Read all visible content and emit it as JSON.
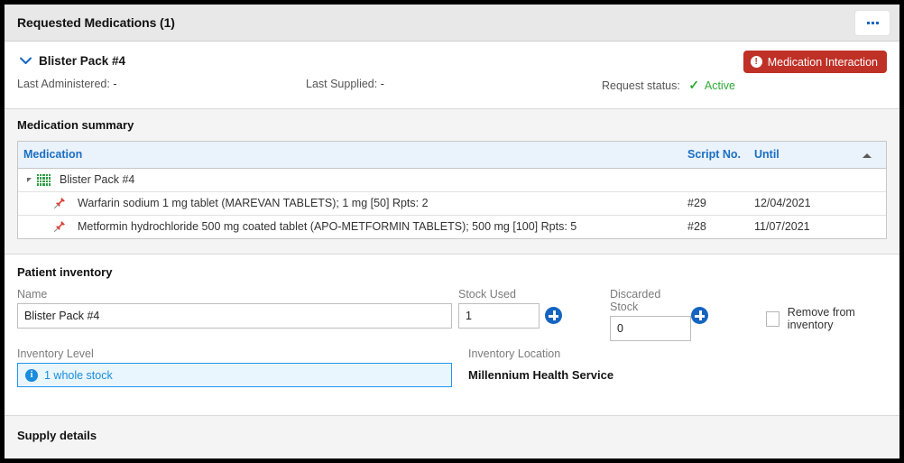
{
  "window": {
    "title": "Requested Medications (1)",
    "overflow_menu_label": "..."
  },
  "request": {
    "pack_name": "Blister Pack #4",
    "chevron_icon": "chevron-down-icon",
    "last_administered_label": "Last Administered:",
    "last_administered_value": "-",
    "last_supplied_label": "Last Supplied:",
    "last_supplied_value": "-",
    "request_status_label": "Request status:",
    "request_status_value": "Active",
    "status_check_icon": "check-icon",
    "interaction_badge": {
      "label": "Medication Interaction",
      "icon": "alert-exclamation-icon",
      "glyph": "!",
      "color": "#bf3026"
    }
  },
  "medication_summary": {
    "title": "Medication summary",
    "columns": {
      "medication": "Medication",
      "script_no": "Script No.",
      "until": "Until"
    },
    "sort_icon": "sort-ascending-icon",
    "group": {
      "label": "Blister Pack #4",
      "icon": "blister-pack-icon",
      "toggle_icon": "triangle-expanded-icon",
      "script_no": "",
      "until": ""
    },
    "rows": [
      {
        "icon": "pin-icon",
        "medication": "Warfarin sodium 1 mg tablet (MAREVAN TABLETS); 1 mg [50] Rpts: 2",
        "script_no": "#29",
        "until": "12/04/2021"
      },
      {
        "icon": "pin-icon",
        "medication": "Metformin hydrochloride 500 mg coated tablet (APO-METFORMIN TABLETS); 500 mg [100] Rpts: 5",
        "script_no": "#28",
        "until": "11/07/2021"
      }
    ]
  },
  "patient_inventory": {
    "title": "Patient inventory",
    "name_label": "Name",
    "name_value": "Blister Pack #4",
    "name_placeholder": "Name",
    "stock_used_label": "Stock Used",
    "stock_used_value": "1",
    "stock_used_add_icon": "plus-circle-icon",
    "discarded_stock_label": "Discarded Stock",
    "discarded_stock_value": "0",
    "discarded_stock_add_icon": "plus-circle-icon",
    "remove_from_inventory_label": "Remove from inventory",
    "remove_from_inventory_checked": false,
    "inventory_level_label": "Inventory Level",
    "inventory_level_value": "1 whole stock",
    "inventory_level_icon": "info-icon",
    "inventory_level_glyph": "i",
    "inventory_location_label": "Inventory Location",
    "inventory_location_value": "Millennium Health Service"
  },
  "supply_details": {
    "title": "Supply details"
  }
}
